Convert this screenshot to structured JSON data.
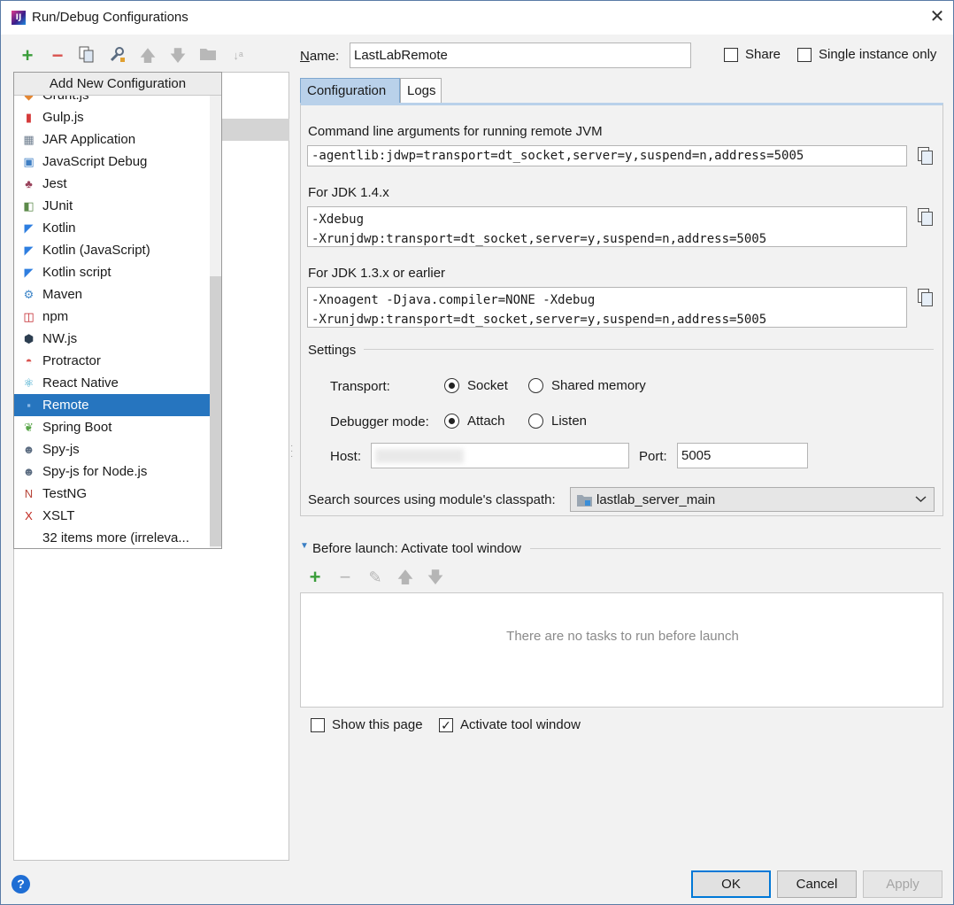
{
  "window": {
    "title": "Run/Debug Configurations"
  },
  "toolbar": {
    "add_icon": "plus-icon",
    "remove_icon": "minus-icon",
    "copy_icon": "copy-icon",
    "edit_defaults_icon": "wrench-icon",
    "up_icon": "arrow-up-icon",
    "down_icon": "arrow-down-icon",
    "folder_icon": "folder-icon",
    "sort_icon": "sort-az-icon"
  },
  "popup": {
    "header": "Add New Configuration",
    "items": [
      {
        "label": "Grunt.js",
        "icon": "grunt-icon",
        "glyph": "◆",
        "color": "#e48632"
      },
      {
        "label": "Gulp.js",
        "icon": "gulp-icon",
        "glyph": "▮",
        "color": "#d53a3a"
      },
      {
        "label": "JAR Application",
        "icon": "jar-icon",
        "glyph": "▦",
        "color": "#6e7e8f"
      },
      {
        "label": "JavaScript Debug",
        "icon": "javascript-debug-icon",
        "glyph": "▣",
        "color": "#3f7fc4"
      },
      {
        "label": "Jest",
        "icon": "jest-icon",
        "glyph": "♣",
        "color": "#99425b"
      },
      {
        "label": "JUnit",
        "icon": "junit-icon",
        "glyph": "◧",
        "color": "#5c8a4a"
      },
      {
        "label": "Kotlin",
        "icon": "kotlin-icon",
        "glyph": "◤",
        "color": "#2e7ee0"
      },
      {
        "label": "Kotlin (JavaScript)",
        "icon": "kotlin-javascript-icon",
        "glyph": "◤",
        "color": "#2e7ee0"
      },
      {
        "label": "Kotlin script",
        "icon": "kotlin-script-icon",
        "glyph": "◤",
        "color": "#2e7ee0"
      },
      {
        "label": "Maven",
        "icon": "maven-icon",
        "glyph": "⚙",
        "color": "#3f86c8"
      },
      {
        "label": "npm",
        "icon": "npm-icon",
        "glyph": "◫",
        "color": "#c12127"
      },
      {
        "label": "NW.js",
        "icon": "nwjs-icon",
        "glyph": "⬢",
        "color": "#2c3e50"
      },
      {
        "label": "Protractor",
        "icon": "protractor-icon",
        "glyph": "◓",
        "color": "#d9534f"
      },
      {
        "label": "React Native",
        "icon": "react-native-icon",
        "glyph": "⚛",
        "color": "#2aa0c8"
      },
      {
        "label": "Remote",
        "icon": "remote-icon",
        "glyph": "▪",
        "color": "#8ab8e8"
      },
      {
        "label": "Spring Boot",
        "icon": "spring-boot-icon",
        "glyph": "❦",
        "color": "#5aa64a"
      },
      {
        "label": "Spy-js",
        "icon": "spy-js-icon",
        "glyph": "☻",
        "color": "#5a6b80"
      },
      {
        "label": "Spy-js for Node.js",
        "icon": "spy-js-node-icon",
        "glyph": "☻",
        "color": "#5a6b80"
      },
      {
        "label": "TestNG",
        "icon": "testng-icon",
        "glyph": "N",
        "color": "#b8463a"
      },
      {
        "label": "XSLT",
        "icon": "xslt-icon",
        "glyph": "X",
        "color": "#c0281f"
      },
      {
        "label": "32 items more (irreleva...",
        "icon": "",
        "glyph": "",
        "color": "#000000"
      }
    ],
    "selected": "Remote"
  },
  "form": {
    "name_label": "Name:",
    "name_value": "LastLabRemote",
    "share_label": "Share",
    "single_instance_label": "Single instance only",
    "tabs": [
      "Configuration",
      "Logs"
    ],
    "cmd_label": "Command line arguments for running remote JVM",
    "cmd_value": "-agentlib:jdwp=transport=dt_socket,server=y,suspend=n,address=5005",
    "jdk14_label": "For JDK 1.4.x",
    "jdk14_value": "-Xdebug\n-Xrunjdwp:transport=dt_socket,server=y,suspend=n,address=5005",
    "jdk13_label": "For JDK 1.3.x or earlier",
    "jdk13_value": "-Xnoagent -Djava.compiler=NONE -Xdebug\n-Xrunjdwp:transport=dt_socket,server=y,suspend=n,address=5005",
    "settings_label": "Settings",
    "transport_label": "Transport:",
    "transport_socket": "Socket",
    "transport_shared": "Shared memory",
    "debugger_mode_label": "Debugger mode:",
    "mode_attach": "Attach",
    "mode_listen": "Listen",
    "host_label": "Host:",
    "port_label": "Port:",
    "port_value": "5005",
    "classpath_label": "Search sources using module's classpath:",
    "classpath_value": "lastlab_server_main"
  },
  "before_launch": {
    "title": "Before launch: Activate tool window",
    "empty_text": "There are no tasks to run before launch",
    "show_page_label": "Show this page",
    "activate_label": "Activate tool window"
  },
  "buttons": {
    "ok": "OK",
    "cancel": "Cancel",
    "apply": "Apply",
    "help": "?"
  },
  "colors": {
    "selection": "#2675bf",
    "accent_green": "#3a9d3a",
    "accent_red": "#d9534f",
    "tab_active": "#b9d1ea"
  }
}
